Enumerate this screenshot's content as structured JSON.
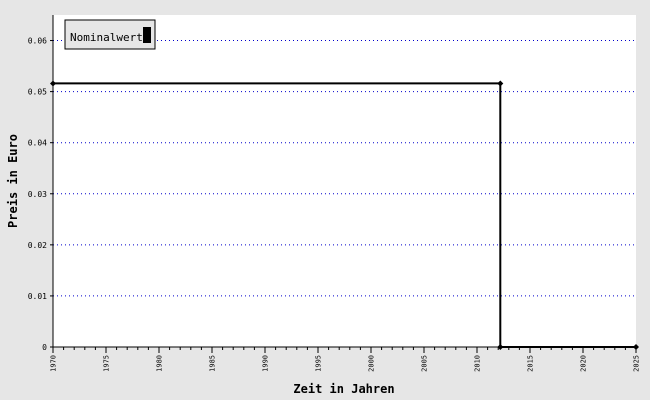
{
  "chart_data": {
    "type": "line",
    "xlabel": "Zeit in Jahren",
    "ylabel": "Preis in Euro",
    "xlim": [
      1970,
      2025
    ],
    "ylim": [
      0,
      0.065
    ],
    "x_ticks": [
      1970,
      1975,
      1980,
      1985,
      1990,
      1995,
      2000,
      2005,
      2010,
      2015,
      2020,
      2025
    ],
    "y_ticks": [
      0,
      0.01,
      0.02,
      0.03,
      0.04,
      0.05,
      0.06
    ],
    "grid": "horizontal dotted",
    "legend_position": "top-left",
    "series": [
      {
        "name": "Nominalwert",
        "color": "#000000",
        "step": true,
        "x": [
          1970,
          2012.2,
          2012.2,
          2025
        ],
        "y": [
          0.0516,
          0.0516,
          0,
          0
        ],
        "markers": [
          [
            1970,
            0.0516
          ],
          [
            2012.2,
            0.0516
          ],
          [
            2012.2,
            0
          ],
          [
            2025,
            0
          ]
        ]
      }
    ]
  },
  "colors": {
    "grid": "#0000cc",
    "background": "#e6e6e6",
    "plot_background": "#ffffff"
  }
}
